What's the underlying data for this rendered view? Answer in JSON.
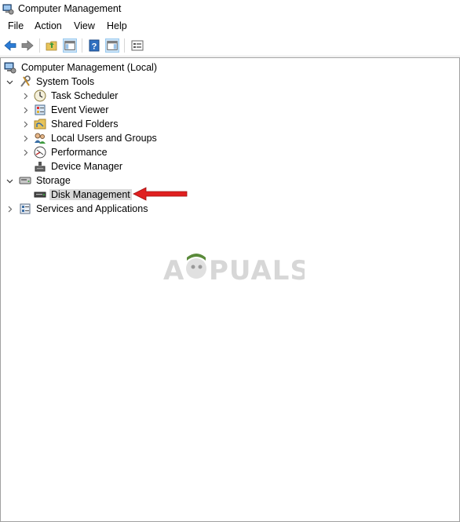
{
  "window": {
    "title": "Computer Management"
  },
  "menu": [
    "File",
    "Action",
    "View",
    "Help"
  ],
  "toolbar": {
    "buttons": [
      "back-icon",
      "forward-icon",
      "up-folder-icon",
      "show-hide-console-tree-icon",
      "help-icon",
      "show-hide-action-pane-icon",
      "properties-icon"
    ]
  },
  "tree": {
    "root": "Computer Management (Local)",
    "system_tools": {
      "label": "System Tools",
      "children": [
        "Task Scheduler",
        "Event Viewer",
        "Shared Folders",
        "Local Users and Groups",
        "Performance",
        "Device Manager"
      ]
    },
    "storage": {
      "label": "Storage",
      "children": [
        "Disk Management"
      ]
    },
    "services": {
      "label": "Services and Applications"
    }
  },
  "selected_item": "Disk Management",
  "watermark": "APPUALS",
  "annotation": {
    "arrow_color": "#e02020"
  }
}
